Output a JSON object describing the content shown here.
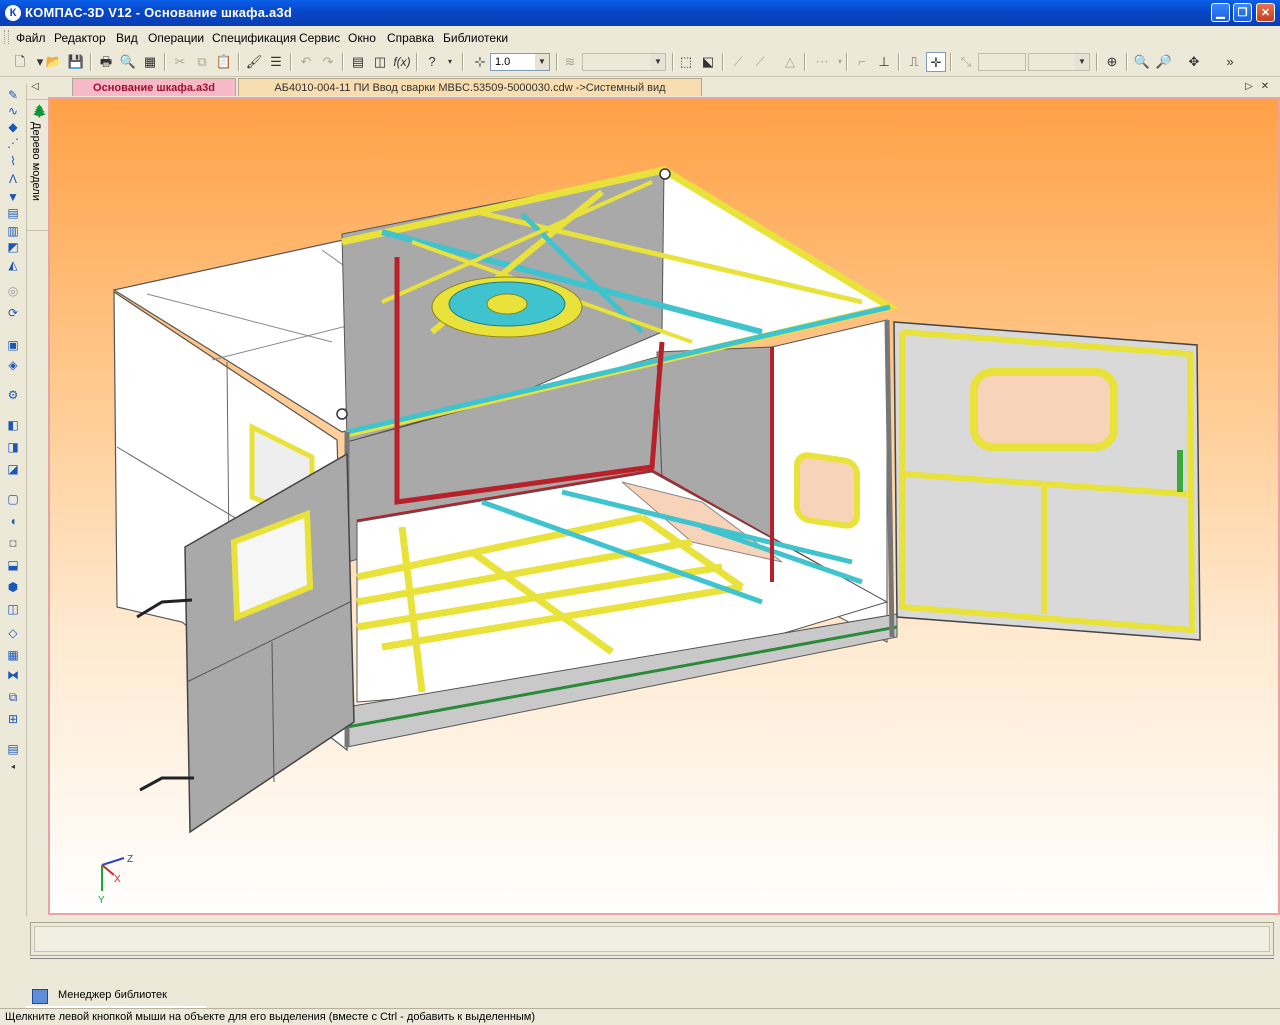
{
  "window": {
    "title": "КОМПАС-3D V12 - Основание шкафа.a3d",
    "app_icon": "К",
    "minimize_icon": "minimize-icon",
    "maximize_icon": "restore-icon",
    "close_icon": "close-icon"
  },
  "menu": [
    "Файл",
    "Редактор",
    "Вид",
    "Операции",
    "Спецификация",
    "Сервис",
    "Окно",
    "Справка",
    "Библиотеки"
  ],
  "toolbar": {
    "scale_value": "1.0",
    "formula_label": "f(x)"
  },
  "tabs": [
    {
      "label": "Основание шкафа.a3d",
      "active": true
    },
    {
      "label": "АБ4010-004-11 ПИ Ввод сварки МВБС.53509-5000030.cdw ->Системный вид",
      "active": false
    }
  ],
  "tree_panel": {
    "label": "Дерево модели"
  },
  "axes": {
    "z": "Z",
    "x": "X",
    "y": "Y"
  },
  "library_manager": {
    "label": "Менеджер библиотек"
  },
  "status": {
    "text": "Щелкните левой кнопкой мыши на объекте для его выделения (вместе с Ctrl - добавить к выделенным)"
  },
  "colors": {
    "frame_yellow": "#e8e23a",
    "frame_cyan": "#3ec3cf",
    "frame_red": "#b8202a",
    "panel_gray": "#a9a9a9",
    "panel_white": "#ffffff",
    "accent_tab_active": "#f5b9c8",
    "accent_tab_inactive": "#f7ddb0"
  }
}
